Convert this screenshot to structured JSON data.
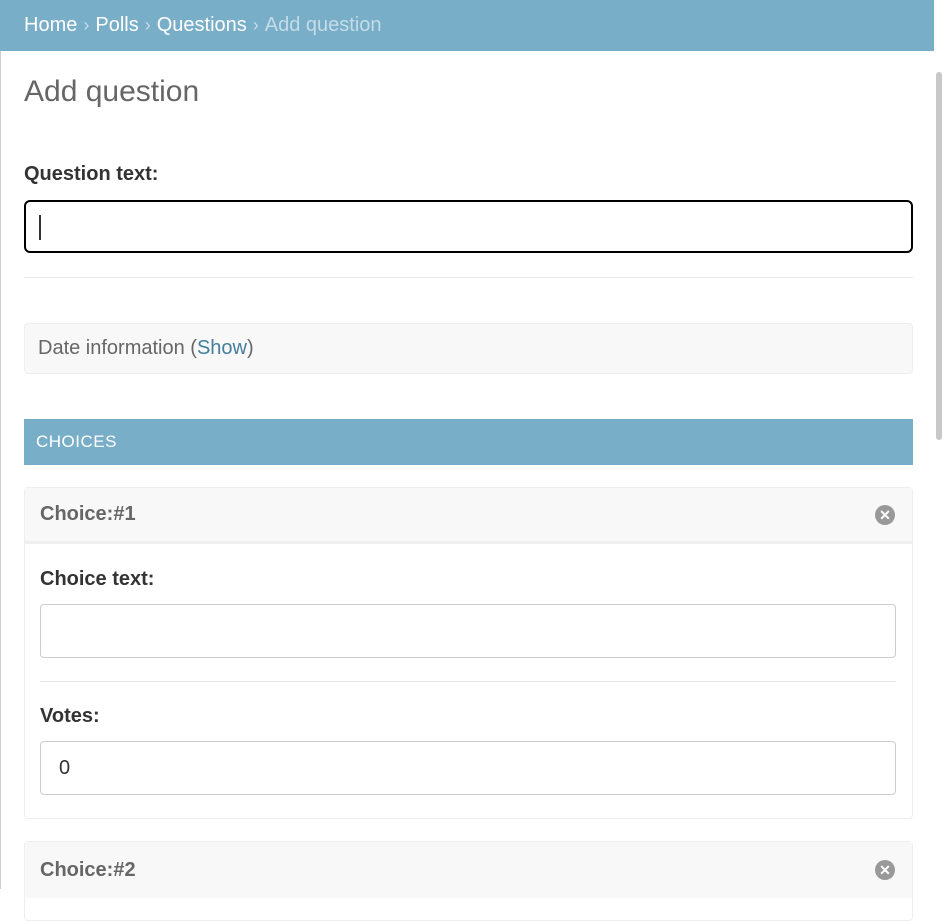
{
  "breadcrumbs": {
    "home": "Home",
    "polls": "Polls",
    "questions": "Questions",
    "current": "Add question",
    "separator": "›"
  },
  "page": {
    "title": "Add question"
  },
  "question_field": {
    "label": "Question text:",
    "value": ""
  },
  "date_info": {
    "prefix": "Date information (",
    "link": "Show",
    "suffix": ")"
  },
  "choices": {
    "header": "CHOICES",
    "items": [
      {
        "title": "Choice:#1",
        "choice_text_label": "Choice text:",
        "choice_text_value": "",
        "votes_label": "Votes:",
        "votes_value": "0"
      },
      {
        "title": "Choice:#2"
      }
    ],
    "delete_icon": "close-circle-icon"
  },
  "colors": {
    "accent": "#79aec8",
    "link": "#447e9b"
  }
}
